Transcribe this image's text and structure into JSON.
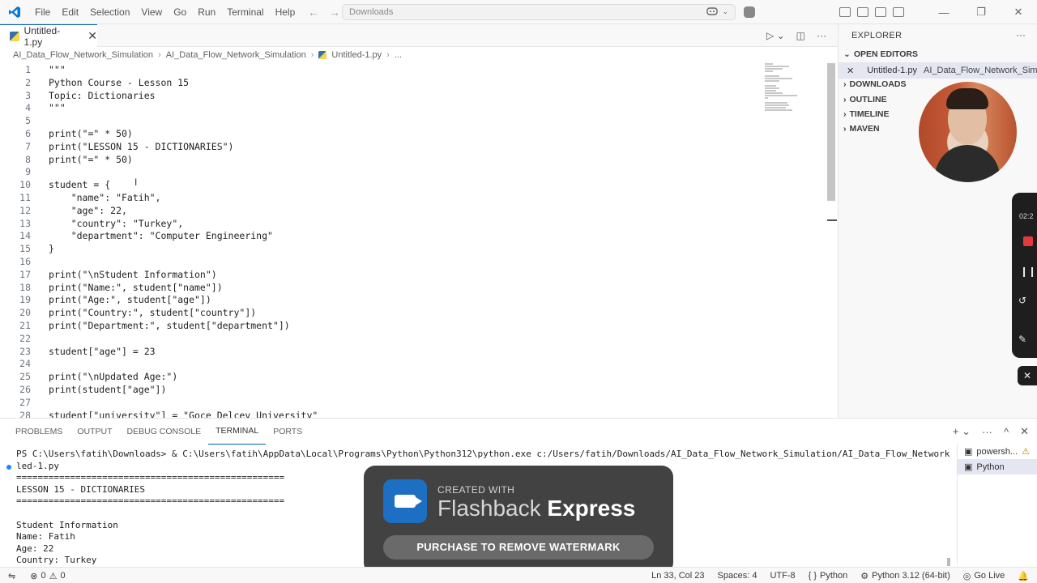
{
  "titlebar": {
    "menu": [
      "File",
      "Edit",
      "Selection",
      "View",
      "Go",
      "Run",
      "Terminal",
      "Help"
    ],
    "search": "Downloads"
  },
  "tab": {
    "label": "Untitled-1.py"
  },
  "breadcrumb": [
    "AI_Data_Flow_Network_Simulation",
    "AI_Data_Flow_Network_Simulation",
    "Untitled-1.py",
    "..."
  ],
  "code": [
    {
      "n": "1",
      "t": "\"\"\""
    },
    {
      "n": "2",
      "t": "Python Course - Lesson 15"
    },
    {
      "n": "3",
      "t": "Topic: Dictionaries"
    },
    {
      "n": "4",
      "t": "\"\"\""
    },
    {
      "n": "5",
      "t": ""
    },
    {
      "n": "6",
      "t": "print(\"=\" * 50)"
    },
    {
      "n": "7",
      "t": "print(\"LESSON 15 - DICTIONARIES\")"
    },
    {
      "n": "8",
      "t": "print(\"=\" * 50)"
    },
    {
      "n": "9",
      "t": ""
    },
    {
      "n": "10",
      "t": "student = {"
    },
    {
      "n": "11",
      "t": "    \"name\": \"Fatih\","
    },
    {
      "n": "12",
      "t": "    \"age\": 22,"
    },
    {
      "n": "13",
      "t": "    \"country\": \"Turkey\","
    },
    {
      "n": "14",
      "t": "    \"department\": \"Computer Engineering\""
    },
    {
      "n": "15",
      "t": "}"
    },
    {
      "n": "16",
      "t": ""
    },
    {
      "n": "17",
      "t": "print(\"\\nStudent Information\")"
    },
    {
      "n": "18",
      "t": "print(\"Name:\", student[\"name\"])"
    },
    {
      "n": "19",
      "t": "print(\"Age:\", student[\"age\"])"
    },
    {
      "n": "20",
      "t": "print(\"Country:\", student[\"country\"])"
    },
    {
      "n": "21",
      "t": "print(\"Department:\", student[\"department\"])"
    },
    {
      "n": "22",
      "t": ""
    },
    {
      "n": "23",
      "t": "student[\"age\"] = 23"
    },
    {
      "n": "24",
      "t": ""
    },
    {
      "n": "25",
      "t": "print(\"\\nUpdated Age:\")"
    },
    {
      "n": "26",
      "t": "print(student[\"age\"])"
    },
    {
      "n": "27",
      "t": ""
    },
    {
      "n": "28",
      "t": "student[\"university\"] = \"Goce Delcev University\""
    }
  ],
  "explorer": {
    "title": "EXPLORER",
    "open_editors": "OPEN EDITORS",
    "open_file": "Untitled-1.py",
    "open_file_path": "AI_Data_Flow_Network_Simula...",
    "sections": [
      "DOWNLOADS",
      "OUTLINE",
      "TIMELINE",
      "MAVEN"
    ]
  },
  "recorder": {
    "time": "02:2"
  },
  "panel": {
    "tabs": [
      "PROBLEMS",
      "OUTPUT",
      "DEBUG CONSOLE",
      "TERMINAL",
      "PORTS"
    ],
    "active_tab": "TERMINAL",
    "terminal_lines": [
      "PS C:\\Users\\fatih\\Downloads> & C:\\Users\\fatih\\AppData\\Local\\Programs\\Python\\Python312\\python.exe c:/Users/fatih/Downloads/AI_Data_Flow_Network_Simulation/AI_Data_Flow_Network_Simulation/Untit",
      "led-1.py",
      "==================================================",
      "LESSON 15 - DICTIONARIES",
      "==================================================",
      "",
      "Student Information",
      "Name: Fatih",
      "Age: 22",
      "Country: Turkey"
    ],
    "terminals": [
      "powersh...",
      "Python"
    ]
  },
  "watermark": {
    "small": "CREATED WITH",
    "brand_a": "Flashback",
    "brand_b": "Express",
    "button": "PURCHASE TO REMOVE WATERMARK"
  },
  "status": {
    "errors": "0",
    "warnings": "0",
    "position": "Ln 33, Col 23",
    "spaces": "Spaces: 4",
    "encoding": "UTF-8",
    "language": "Python",
    "interpreter": "Python 3.12 (64-bit)",
    "golive": "Go Live"
  },
  "colors": {
    "accent": "#005fb8",
    "selection": "#e4e6f1"
  }
}
